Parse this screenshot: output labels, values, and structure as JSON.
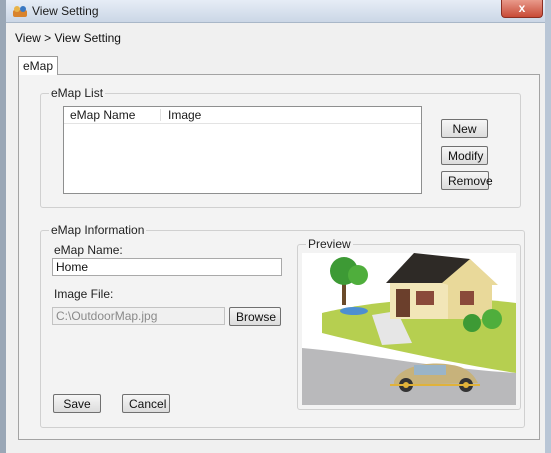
{
  "window": {
    "title": "View Setting",
    "close_glyph": "x"
  },
  "breadcrumb": "View > View Setting",
  "tabs": [
    {
      "label": "eMap",
      "selected": true
    }
  ],
  "emap_list": {
    "group_title": "eMap List",
    "columns": [
      "eMap Name",
      "Image"
    ],
    "rows": [],
    "buttons": {
      "new": "New",
      "modify": "Modify",
      "remove": "Remove"
    }
  },
  "emap_info": {
    "group_title": "eMap Information",
    "name_label": "eMap Name:",
    "name_value": "Home",
    "image_label": "Image File:",
    "image_value": "C:\\OutdoorMap.jpg",
    "browse_label": "Browse",
    "save_label": "Save",
    "cancel_label": "Cancel"
  },
  "preview": {
    "title": "Preview",
    "image_icon": "house-car-preview-image"
  },
  "colors": {
    "titlebar_top": "#e6edf6",
    "titlebar_bottom": "#cbd7e6",
    "close_button": "#c84b37",
    "panel_background": "#f3f3f3"
  }
}
